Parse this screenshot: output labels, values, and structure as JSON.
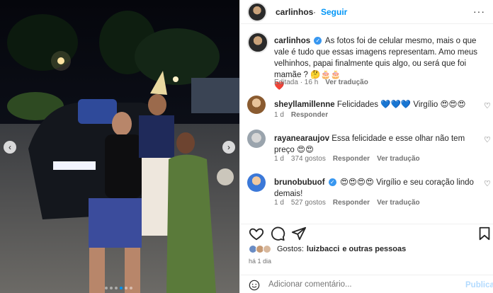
{
  "post": {
    "username": "carlinhos",
    "follow_label": "Seguir",
    "more_label": "···"
  },
  "caption": {
    "username": "carlinhos",
    "text": "As fotos foi de celular mesmo, mais o que vale é tudo que essas imagens representam. Amo meus velhinhos, papai finalmente quis algo, ou será que foi mamãe ? 🤔🎂🎂",
    "heart": "❤️",
    "edited": "Editada · 16 h",
    "translate": "Ver tradução"
  },
  "comments": [
    {
      "username": "sheyllamillenne",
      "text": "Felicidades 💙💙💙 Virgílio 😍😍😍",
      "time": "1 d",
      "reply": "Responder",
      "likes": "",
      "translate": ""
    },
    {
      "username": "rayanearaujov",
      "text": "Essa felicidade e esse olhar não tem preço 😍😍",
      "time": "1 d",
      "likes": "374 gostos",
      "reply": "Responder",
      "translate": "Ver tradução"
    },
    {
      "username": "brunobubuof",
      "text": "😍😍😍😍 Virgílio e seu coração lindo demais!",
      "time": "1 d",
      "likes": "527 gostos",
      "reply": "Responder",
      "translate": "Ver tradução"
    }
  ],
  "likes": {
    "prefix": "Gostos:",
    "user": "luizbacci",
    "suffix": "e outras pessoas"
  },
  "posted": "há 1 dia",
  "add_comment": {
    "placeholder": "Adicionar comentário...",
    "post_label": "Publicar"
  },
  "photo": {
    "prev": "‹",
    "next": "›"
  },
  "colors": {
    "accent": "#0095f6",
    "verified": "#3897f0",
    "muted": "#737373"
  }
}
